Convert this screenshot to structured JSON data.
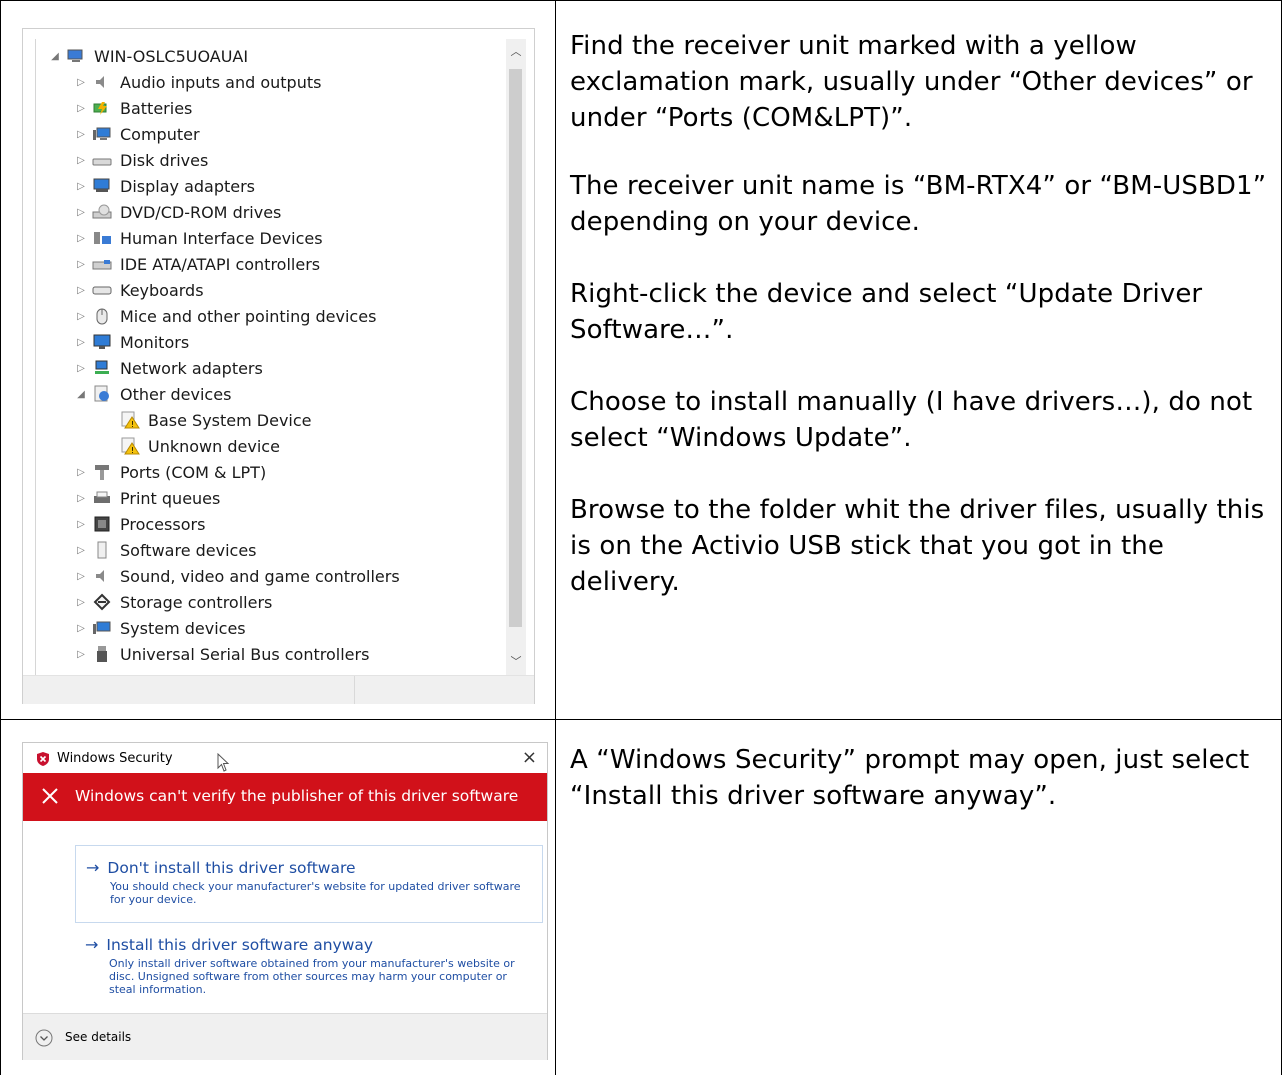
{
  "device_manager": {
    "root": "WIN-OSLC5UOAUAI",
    "items": [
      {
        "label": "Audio inputs and outputs",
        "icon": "speaker-icon"
      },
      {
        "label": "Batteries",
        "icon": "battery-icon"
      },
      {
        "label": "Computer",
        "icon": "computer-icon"
      },
      {
        "label": "Disk drives",
        "icon": "disk-drive-icon"
      },
      {
        "label": "Display adapters",
        "icon": "display-adapter-icon"
      },
      {
        "label": "DVD/CD-ROM drives",
        "icon": "dvd-drive-icon"
      },
      {
        "label": "Human Interface Devices",
        "icon": "hid-icon"
      },
      {
        "label": "IDE ATA/ATAPI controllers",
        "icon": "ide-controller-icon"
      },
      {
        "label": "Keyboards",
        "icon": "keyboard-icon"
      },
      {
        "label": "Mice and other pointing devices",
        "icon": "mouse-icon"
      },
      {
        "label": "Monitors",
        "icon": "monitor-icon"
      },
      {
        "label": "Network adapters",
        "icon": "network-adapter-icon"
      },
      {
        "label": "Other devices",
        "icon": "other-devices-icon"
      },
      {
        "label": "Base System Device",
        "icon": "warning-device-icon"
      },
      {
        "label": "Unknown device",
        "icon": "warning-device-icon"
      },
      {
        "label": "Ports (COM & LPT)",
        "icon": "port-icon"
      },
      {
        "label": "Print queues",
        "icon": "printer-icon"
      },
      {
        "label": "Processors",
        "icon": "processor-icon"
      },
      {
        "label": "Software devices",
        "icon": "software-device-icon"
      },
      {
        "label": "Sound, video and game controllers",
        "icon": "sound-icon"
      },
      {
        "label": "Storage controllers",
        "icon": "storage-icon"
      },
      {
        "label": "System devices",
        "icon": "system-device-icon"
      },
      {
        "label": "Universal Serial Bus controllers",
        "icon": "usb-icon"
      }
    ]
  },
  "instructions": {
    "step1": "Find the receiver unit marked with a yellow exclamation mark, usually under “Other devices” or under “Ports (COM&LPT)”.",
    "step2": "The receiver unit name is “BM-RTX4” or “BM-USBD1” depending on your device.",
    "step3": "Right-click the device and select “Update Driver Software…”.",
    "step4": "Choose to install manually (I have drivers…), do not select “Windows Update”.",
    "step5": "Browse to the folder whit the driver files, usually this is on the Activio USB stick that you got in the delivery.",
    "step6": "A “Windows Security” prompt may open, just select “Install this driver software anyway”."
  },
  "security_dialog": {
    "title": "Windows Security",
    "close": "×",
    "banner": "Windows can't verify the publisher of this driver software",
    "option1_title": "Don't install this driver software",
    "option1_desc": "You should check your manufacturer's website for updated driver software for your device.",
    "option2_title": "Install this driver software anyway",
    "option2_desc": "Only install driver software obtained from your manufacturer's website or disc. Unsigned software from other sources may harm your computer or steal information.",
    "details": "See details",
    "arrow": "→"
  },
  "colors": {
    "banner": "#d1111a",
    "link": "#1f4ea3"
  }
}
